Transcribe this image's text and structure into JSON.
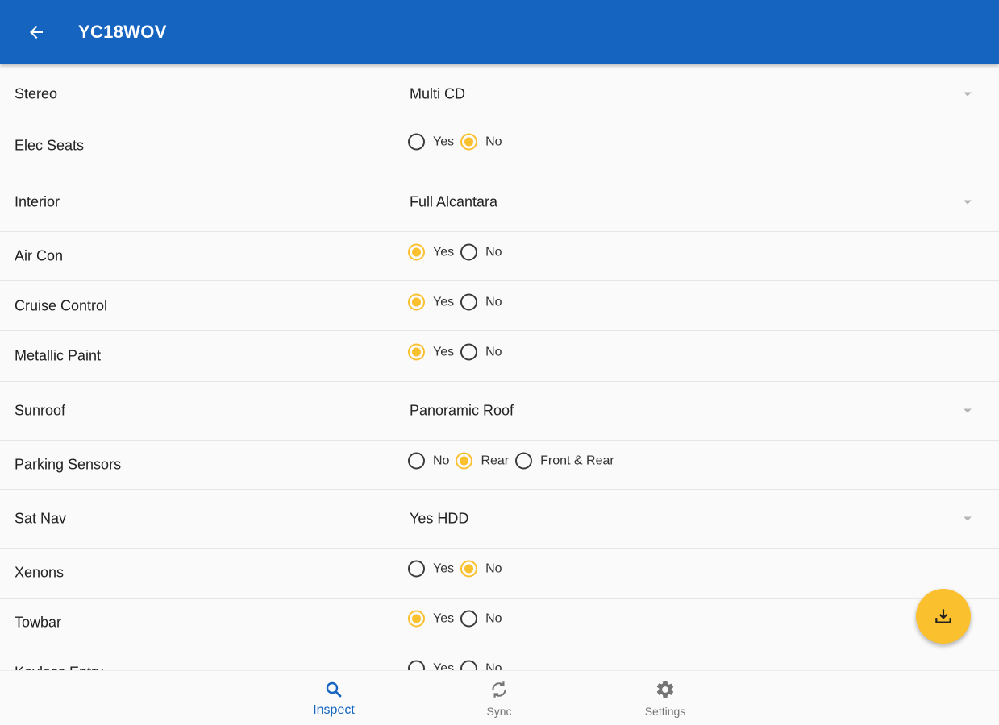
{
  "appbar": {
    "title": "YC18WOV",
    "back_icon": "arrow-left-icon"
  },
  "rows": [
    {
      "label": "Stereo",
      "type": "dropdown",
      "value": "Multi CD"
    },
    {
      "label": "Elec Seats",
      "type": "radio",
      "options": [
        "Yes",
        "No"
      ],
      "selected": "No"
    },
    {
      "label": "Interior",
      "type": "dropdown",
      "value": "Full Alcantara"
    },
    {
      "label": "Air Con",
      "type": "radio",
      "options": [
        "Yes",
        "No"
      ],
      "selected": "Yes"
    },
    {
      "label": "Cruise Control",
      "type": "radio",
      "options": [
        "Yes",
        "No"
      ],
      "selected": "Yes"
    },
    {
      "label": "Metallic Paint",
      "type": "radio",
      "options": [
        "Yes",
        "No"
      ],
      "selected": "Yes"
    },
    {
      "label": "Sunroof",
      "type": "dropdown",
      "value": "Panoramic Roof"
    },
    {
      "label": "Parking Sensors",
      "type": "radio",
      "options": [
        "No",
        "Rear",
        "Front & Rear"
      ],
      "selected": "Rear"
    },
    {
      "label": "Sat Nav",
      "type": "dropdown",
      "value": "Yes HDD"
    },
    {
      "label": "Xenons",
      "type": "radio",
      "options": [
        "Yes",
        "No"
      ],
      "selected": "No"
    },
    {
      "label": "Towbar",
      "type": "radio",
      "options": [
        "Yes",
        "No"
      ],
      "selected": "Yes"
    },
    {
      "label": "Keyless Entry",
      "type": "radio",
      "options": [
        "Yes",
        "No"
      ],
      "selected": null
    }
  ],
  "fab": {
    "icon": "download-icon"
  },
  "bottom_nav": {
    "items": [
      {
        "label": "Inspect",
        "icon": "search-icon",
        "active": true
      },
      {
        "label": "Sync",
        "icon": "sync-icon",
        "active": false
      },
      {
        "label": "Settings",
        "icon": "gear-icon",
        "active": false
      }
    ]
  },
  "colors": {
    "primary": "#1565c0",
    "accent": "#fbc02d",
    "background": "#fafafa"
  }
}
